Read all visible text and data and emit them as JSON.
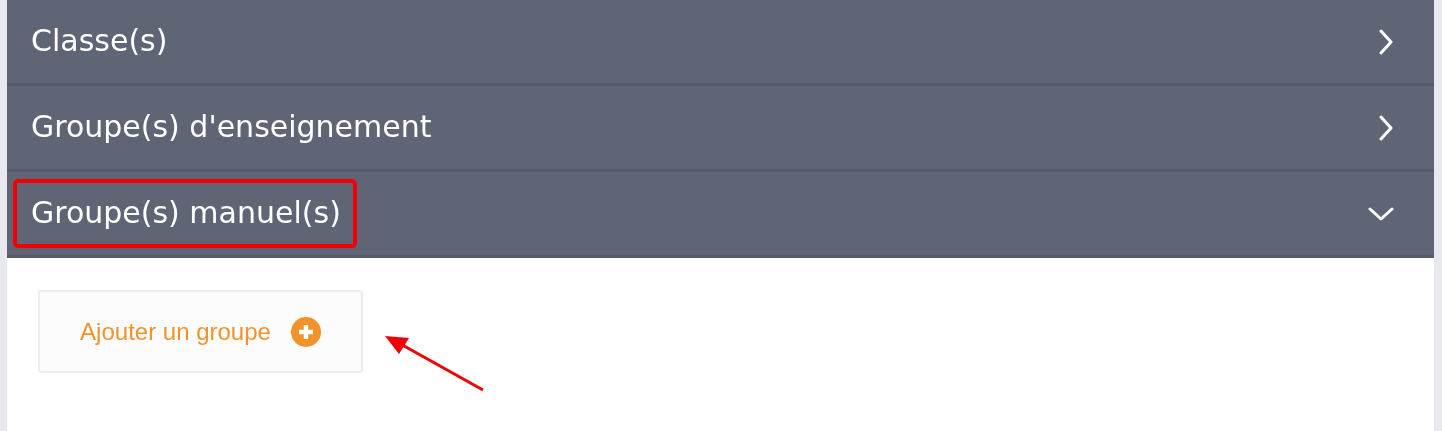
{
  "sections": [
    {
      "title": "Classe(s)",
      "expanded": false,
      "highlighted": false
    },
    {
      "title": "Groupe(s) d'enseignement",
      "expanded": false,
      "highlighted": false
    },
    {
      "title": "Groupe(s) manuel(s)",
      "expanded": true,
      "highlighted": true
    }
  ],
  "add_button": {
    "label": "Ajouter un groupe"
  },
  "annotation_arrow": true
}
